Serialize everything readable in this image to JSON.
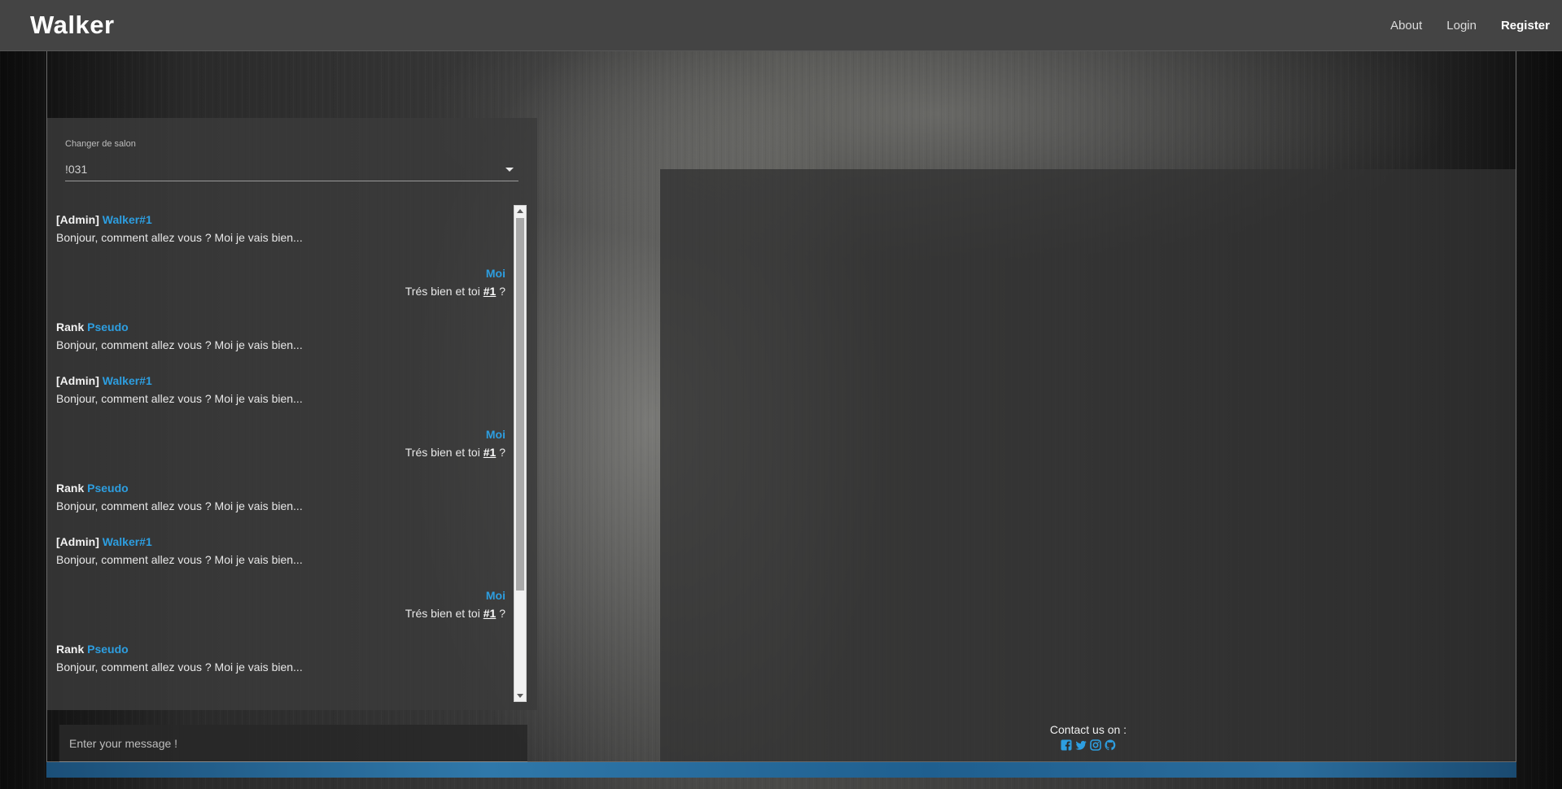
{
  "navbar": {
    "brand": "Walker",
    "links": [
      "About",
      "Login",
      "Register"
    ]
  },
  "chat": {
    "room_label": "Changer de salon",
    "room_value": "!031",
    "input_placeholder": "Enter your message !",
    "messages": [
      {
        "rank": "[Admin]",
        "name": "Walker#1",
        "text": "Bonjour, comment allez vous ? Moi je vais bien...",
        "self": false
      },
      {
        "rank": "",
        "name": "Moi",
        "text_before": "Trés bien et toi ",
        "mention": "#1",
        "text_after": " ?",
        "self": true
      },
      {
        "rank": "Rank",
        "name": "Pseudo",
        "text": "Bonjour, comment allez vous ? Moi je vais bien...",
        "self": false
      },
      {
        "rank": "[Admin]",
        "name": "Walker#1",
        "text": "Bonjour, comment allez vous ? Moi je vais bien...",
        "self": false
      },
      {
        "rank": "",
        "name": "Moi",
        "text_before": "Trés bien et toi ",
        "mention": "#1",
        "text_after": " ?",
        "self": true
      },
      {
        "rank": "Rank",
        "name": "Pseudo",
        "text": "Bonjour, comment allez vous ? Moi je vais bien...",
        "self": false
      },
      {
        "rank": "[Admin]",
        "name": "Walker#1",
        "text": "Bonjour, comment allez vous ? Moi je vais bien...",
        "self": false
      },
      {
        "rank": "",
        "name": "Moi",
        "text_before": "Trés bien et toi ",
        "mention": "#1",
        "text_after": " ?",
        "self": true
      },
      {
        "rank": "Rank",
        "name": "Pseudo",
        "text": "Bonjour, comment allez vous ? Moi je vais bien...",
        "self": false
      }
    ]
  },
  "footer": {
    "contact_label": "Contact us on :",
    "social_icons": [
      "facebook-icon",
      "twitter-icon",
      "instagram-icon",
      "github-icon"
    ],
    "icon_color": "#2d9ee0"
  },
  "colors": {
    "accent": "#2d9ee0",
    "navbar": "#444444",
    "strip": "#2f78aa"
  }
}
